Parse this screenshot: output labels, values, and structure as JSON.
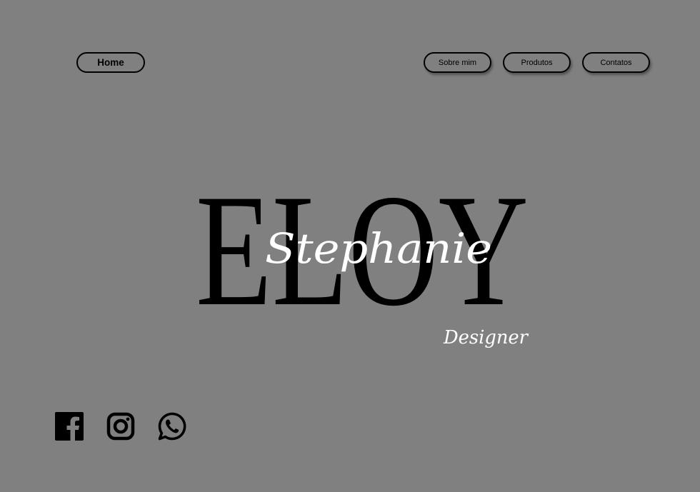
{
  "nav": {
    "home_label": "Home",
    "sobre_label": "Sobre mim",
    "produtos_label": "Produtos",
    "contatos_label": "Contatos"
  },
  "logo": {
    "surname": "ELOY",
    "first_name": "Stephanie",
    "role": "Designer"
  },
  "social": {
    "items": [
      {
        "icon": "facebook-icon"
      },
      {
        "icon": "instagram-icon"
      },
      {
        "icon": "whatsapp-icon"
      }
    ]
  },
  "colors": {
    "background": "#808080",
    "ink": "#000000",
    "script": "#ffffff"
  }
}
